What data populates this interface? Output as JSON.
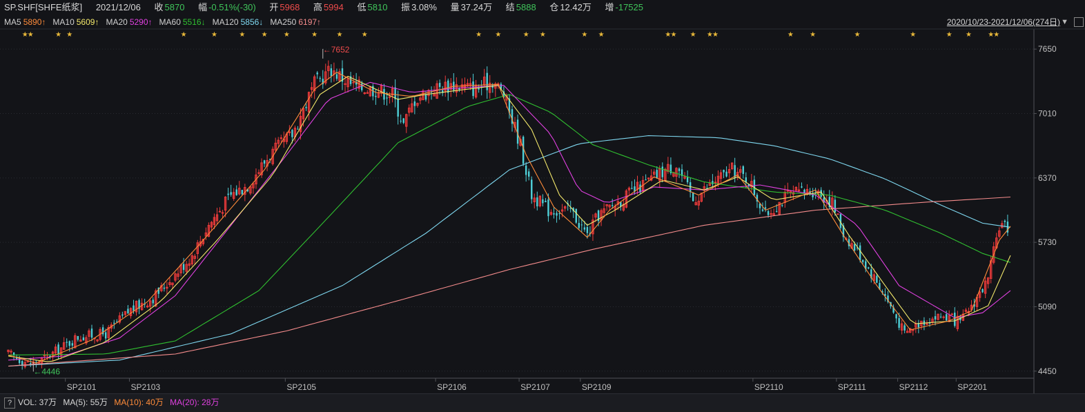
{
  "header": {
    "symbol": "SP.SHF[SHFE纸浆]",
    "date": "2021/12/06",
    "close_label": "收",
    "close": "5870",
    "change_label": "幅",
    "change": "-0.51%(-30)",
    "open_label": "开",
    "open": "5968",
    "high_label": "高",
    "high": "5994",
    "low_label": "低",
    "low": "5810",
    "amp_label": "振",
    "amp": "3.08%",
    "volume_label": "量",
    "volume": "37.24万",
    "settle_label": "结",
    "settle": "5888",
    "oi_label": "仓",
    "oi": "12.42万",
    "oi_change_label": "增",
    "oi_change": "-17525"
  },
  "ma_legend": [
    {
      "label": "MA5",
      "value": "5890↑",
      "color": "#ff8c3a"
    },
    {
      "label": "MA10",
      "value": "5609↑",
      "color": "#f3e86b"
    },
    {
      "label": "MA20",
      "value": "5290↑",
      "color": "#e040e0"
    },
    {
      "label": "MA60",
      "value": "5516↓",
      "color": "#30c030"
    },
    {
      "label": "MA120",
      "value": "5856↓",
      "color": "#7fd8f0"
    },
    {
      "label": "MA250",
      "value": "6197↑",
      "color": "#f58c8c"
    }
  ],
  "range_text": "2020/10/23-2021/12/06(274日)",
  "range_arrow": "▼",
  "footer": {
    "help": "?",
    "vol": "VOL: 37万",
    "ma5": "MA(5): 55万",
    "ma10": "MA(10): 40万",
    "ma20": "MA(20): 28万",
    "ma5_color": "#d8d8d8",
    "ma10_color": "#ff8c3a",
    "ma20_color": "#e040e0"
  },
  "colors": {
    "up": "#ee3b3b",
    "down": "#4fd0d8",
    "grid": "#2a2c32",
    "axis": "#505257",
    "star": "#e8b83a"
  },
  "chart_data": {
    "type": "candlestick",
    "y_ticks": [
      7650,
      7010,
      6370,
      5730,
      5090,
      4450
    ],
    "y_ticks_text": [
      "7650",
      "7010",
      "6370",
      "5730",
      "5090",
      "4450"
    ],
    "ylim": [
      4380,
      7850
    ],
    "bar_count": 274,
    "x_ticks": [
      {
        "label": "SP2101",
        "index": 21
      },
      {
        "label": "SP2103",
        "index": 44
      },
      {
        "label": "SP2105",
        "index": 100
      },
      {
        "label": "SP2106",
        "index": 154
      },
      {
        "label": "SP2107",
        "index": 184
      },
      {
        "label": "SP2109",
        "index": 206
      },
      {
        "label": "SP2110",
        "index": 268
      },
      {
        "label": "SP2111",
        "index": 298
      },
      {
        "label": "SP2112",
        "index": 320
      },
      {
        "label": "SP2201",
        "index": 341
      }
    ],
    "high_mark": {
      "label": "←7652",
      "value": 7652,
      "index": 113
    },
    "low_mark": {
      "label": "←4446",
      "value": 4446,
      "index": 9
    },
    "close_anchors": [
      [
        0,
        4620
      ],
      [
        8,
        4520
      ],
      [
        12,
        4560
      ],
      [
        18,
        4660
      ],
      [
        25,
        4790
      ],
      [
        35,
        4820
      ],
      [
        44,
        5060
      ],
      [
        52,
        5180
      ],
      [
        58,
        5350
      ],
      [
        66,
        5600
      ],
      [
        72,
        5900
      ],
      [
        80,
        6200
      ],
      [
        86,
        6300
      ],
      [
        94,
        6600
      ],
      [
        102,
        6800
      ],
      [
        110,
        7300
      ],
      [
        116,
        7450
      ],
      [
        124,
        7280
      ],
      [
        132,
        7250
      ],
      [
        138,
        7200
      ],
      [
        142,
        6900
      ],
      [
        146,
        7150
      ],
      [
        152,
        7250
      ],
      [
        160,
        7300
      ],
      [
        168,
        7250
      ],
      [
        174,
        7340
      ],
      [
        178,
        7200
      ],
      [
        184,
        6700
      ],
      [
        188,
        6200
      ],
      [
        194,
        6050
      ],
      [
        202,
        6050
      ],
      [
        208,
        5800
      ],
      [
        212,
        6000
      ],
      [
        220,
        6150
      ],
      [
        228,
        6300
      ],
      [
        236,
        6450
      ],
      [
        240,
        6500
      ],
      [
        246,
        6150
      ],
      [
        252,
        6300
      ],
      [
        260,
        6450
      ],
      [
        266,
        6350
      ],
      [
        272,
        6000
      ],
      [
        280,
        6200
      ],
      [
        290,
        6250
      ],
      [
        296,
        6120
      ],
      [
        300,
        5820
      ],
      [
        306,
        5600
      ],
      [
        314,
        5250
      ],
      [
        322,
        4820
      ],
      [
        328,
        4950
      ],
      [
        336,
        5000
      ],
      [
        342,
        4930
      ],
      [
        346,
        5100
      ],
      [
        352,
        5350
      ],
      [
        356,
        5900
      ],
      [
        360,
        5870
      ]
    ],
    "ma_series": [
      {
        "name": "MA120",
        "color": "#7fd8f0",
        "points": [
          [
            0,
            4500
          ],
          [
            40,
            4560
          ],
          [
            80,
            4820
          ],
          [
            120,
            5300
          ],
          [
            150,
            5820
          ],
          [
            180,
            6450
          ],
          [
            205,
            6710
          ],
          [
            230,
            6790
          ],
          [
            255,
            6770
          ],
          [
            275,
            6690
          ],
          [
            295,
            6560
          ],
          [
            315,
            6360
          ],
          [
            335,
            6100
          ],
          [
            350,
            5920
          ],
          [
            360,
            5880
          ]
        ]
      },
      {
        "name": "MA250",
        "color": "#f58c8c",
        "points": [
          [
            0,
            4500
          ],
          [
            60,
            4620
          ],
          [
            100,
            4850
          ],
          [
            140,
            5150
          ],
          [
            180,
            5460
          ],
          [
            210,
            5660
          ],
          [
            250,
            5900
          ],
          [
            290,
            6050
          ],
          [
            330,
            6130
          ],
          [
            360,
            6180
          ]
        ]
      },
      {
        "name": "MA60",
        "color": "#30c030",
        "points": [
          [
            0,
            4610
          ],
          [
            35,
            4620
          ],
          [
            60,
            4750
          ],
          [
            90,
            5250
          ],
          [
            115,
            5980
          ],
          [
            140,
            6720
          ],
          [
            165,
            7080
          ],
          [
            180,
            7200
          ],
          [
            195,
            7020
          ],
          [
            210,
            6700
          ],
          [
            230,
            6500
          ],
          [
            250,
            6330
          ],
          [
            275,
            6230
          ],
          [
            295,
            6200
          ],
          [
            315,
            6050
          ],
          [
            335,
            5820
          ],
          [
            350,
            5620
          ],
          [
            360,
            5530
          ]
        ]
      },
      {
        "name": "MA20",
        "color": "#e040e0",
        "points": [
          [
            0,
            4560
          ],
          [
            20,
            4600
          ],
          [
            40,
            4780
          ],
          [
            60,
            5200
          ],
          [
            80,
            5900
          ],
          [
            100,
            6600
          ],
          [
            115,
            7150
          ],
          [
            130,
            7320
          ],
          [
            145,
            7220
          ],
          [
            160,
            7260
          ],
          [
            178,
            7290
          ],
          [
            195,
            6800
          ],
          [
            205,
            6250
          ],
          [
            215,
            6120
          ],
          [
            232,
            6280
          ],
          [
            250,
            6250
          ],
          [
            270,
            6300
          ],
          [
            290,
            6200
          ],
          [
            305,
            5900
          ],
          [
            320,
            5300
          ],
          [
            340,
            4980
          ],
          [
            350,
            5030
          ],
          [
            360,
            5250
          ]
        ]
      },
      {
        "name": "MA10",
        "color": "#f3e86b",
        "points": [
          [
            0,
            4600
          ],
          [
            15,
            4540
          ],
          [
            35,
            4740
          ],
          [
            55,
            5150
          ],
          [
            75,
            5750
          ],
          [
            95,
            6400
          ],
          [
            112,
            7200
          ],
          [
            122,
            7380
          ],
          [
            140,
            7150
          ],
          [
            150,
            7200
          ],
          [
            176,
            7290
          ],
          [
            188,
            6850
          ],
          [
            198,
            6200
          ],
          [
            208,
            5900
          ],
          [
            218,
            6050
          ],
          [
            235,
            6350
          ],
          [
            250,
            6250
          ],
          [
            262,
            6380
          ],
          [
            275,
            6150
          ],
          [
            292,
            6230
          ],
          [
            302,
            5800
          ],
          [
            315,
            5300
          ],
          [
            325,
            4920
          ],
          [
            340,
            4950
          ],
          [
            352,
            5100
          ],
          [
            360,
            5600
          ]
        ]
      },
      {
        "name": "MA5",
        "color": "#ff8c3a",
        "points": [
          [
            0,
            4610
          ],
          [
            10,
            4530
          ],
          [
            30,
            4760
          ],
          [
            50,
            5140
          ],
          [
            70,
            5750
          ],
          [
            92,
            6450
          ],
          [
            110,
            7250
          ],
          [
            118,
            7420
          ],
          [
            132,
            7220
          ],
          [
            145,
            7180
          ],
          [
            160,
            7280
          ],
          [
            176,
            7300
          ],
          [
            186,
            6600
          ],
          [
            196,
            6080
          ],
          [
            208,
            5780
          ],
          [
            216,
            6050
          ],
          [
            232,
            6380
          ],
          [
            248,
            6200
          ],
          [
            262,
            6400
          ],
          [
            272,
            6050
          ],
          [
            290,
            6250
          ],
          [
            300,
            5800
          ],
          [
            312,
            5300
          ],
          [
            324,
            4860
          ],
          [
            338,
            4950
          ],
          [
            346,
            5050
          ],
          [
            356,
            5750
          ],
          [
            360,
            5890
          ]
        ]
      }
    ]
  }
}
